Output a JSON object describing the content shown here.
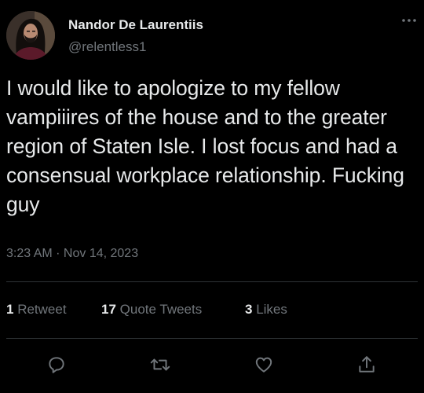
{
  "tweet": {
    "author": {
      "name": "Nandor De Laurentiis",
      "handle": "@relentless1",
      "avatar_icon": "user-avatar-photo"
    },
    "text": "I would like to apologize to my fellow vampiiires of the house and to the greater region of Staten Isle. I lost focus and had a consensual workplace relationship. Fucking guy",
    "timestamp": "3:23 AM · Nov 14, 2023",
    "stats": {
      "retweets": {
        "count": "1",
        "label": "Retweet"
      },
      "quote_tweets": {
        "count": "17",
        "label": "Quote Tweets"
      },
      "likes": {
        "count": "3",
        "label": "Likes"
      }
    },
    "actions": [
      "reply-icon",
      "retweet-icon",
      "like-icon",
      "share-icon"
    ]
  },
  "colors": {
    "background": "#000000",
    "primary_text": "#e7e9ea",
    "secondary_text": "#71767b",
    "divider": "#2f3336"
  }
}
